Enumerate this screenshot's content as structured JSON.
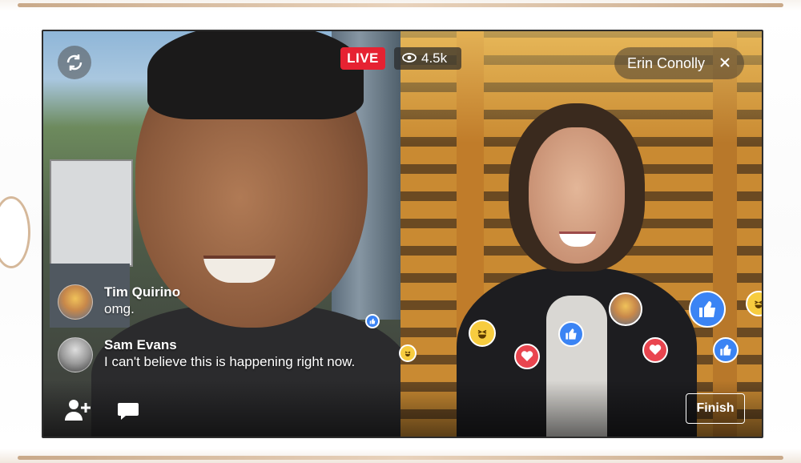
{
  "stream": {
    "live_label": "LIVE",
    "viewer_count": "4.5k",
    "guest_name": "Erin Conolly",
    "finish_label": "Finish"
  },
  "comments": [
    {
      "name": "Tim Quirino",
      "text": "omg."
    },
    {
      "name": "Sam Evans",
      "text": "I can't believe this is happening right now."
    }
  ],
  "icons": {
    "switch_camera": "switch-camera-icon",
    "eye": "eye-icon",
    "close": "close-icon",
    "add_person": "add-person-icon",
    "comment": "comment-icon"
  },
  "colors": {
    "live_red": "#e62232",
    "like_blue": "#3b84f4",
    "love_red": "#e9454f",
    "haha_yellow": "#f7cc3f"
  }
}
